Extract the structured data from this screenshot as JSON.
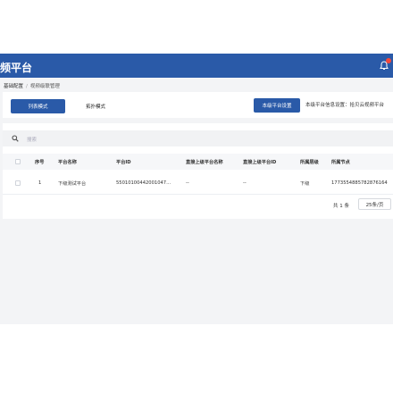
{
  "header": {
    "title": "频平台"
  },
  "breadcrumb": {
    "root": "基础配置",
    "separator": "/",
    "current": "视频级联管理"
  },
  "toolbar": {
    "list_mode": "列表模式",
    "topo_mode": "拓扑模式",
    "local_settings": "本级平台设置",
    "local_info": "本级平台信息设置：拾贝云视频平台"
  },
  "search": {
    "placeholder": "搜索"
  },
  "table": {
    "columns": [
      "序号",
      "平台名称",
      "平台ID",
      "直接上级平台名称",
      "直接上级平台ID",
      "所属层级",
      "所属节点"
    ],
    "rows": [
      {
        "index": "1",
        "name": "下级测试平台",
        "id": "55010100442001047…",
        "parent_name": "--",
        "parent_id": "--",
        "level": "下级",
        "node": "17735548857828761​64"
      }
    ]
  },
  "pagination": {
    "total": "共 1 条",
    "page_size": "25条/页"
  },
  "colors": {
    "primary": "#2a5aa8",
    "badge": "#f5483b"
  }
}
